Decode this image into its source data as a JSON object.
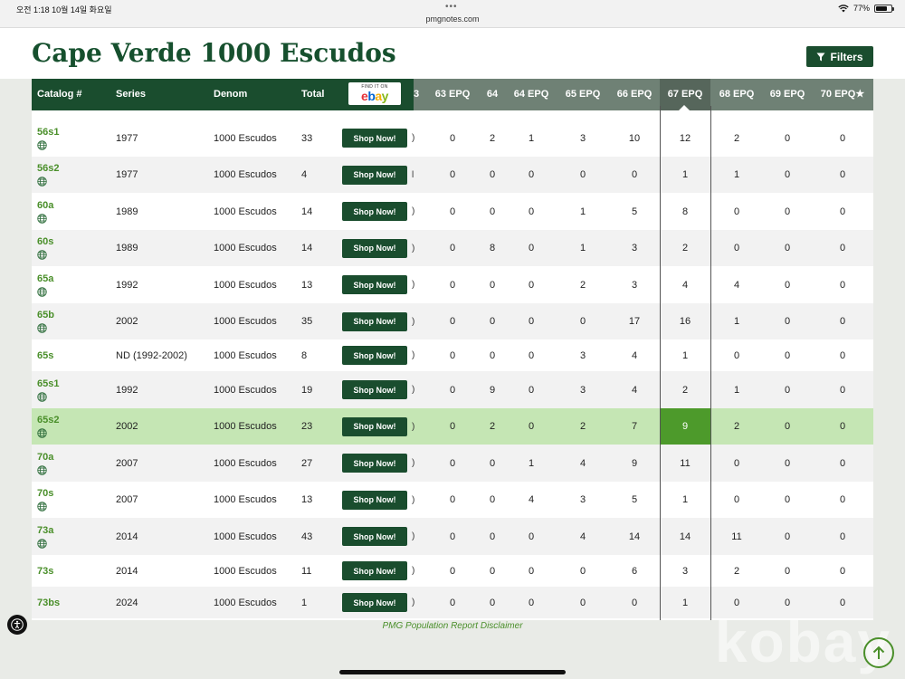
{
  "status_bar": {
    "time": "오전 1:18   10월 14일 화요일",
    "dots": "•••",
    "url": "pmgnotes.com",
    "battery": "77%"
  },
  "header": {
    "title": "Cape Verde 1000 Escudos",
    "filters_label": "Filters"
  },
  "table": {
    "columns": {
      "catalog": "Catalog #",
      "series": "Series",
      "denom": "Denom",
      "total": "Total",
      "cut": "3",
      "c63epq": "63 EPQ",
      "c64": "64",
      "c64epq": "64 EPQ",
      "c65epq": "65 EPQ",
      "c66epq": "66 EPQ",
      "c67epq": "67 EPQ",
      "c68epq": "68 EPQ",
      "c69epq": "69 EPQ",
      "c70epq": "70 EPQ★"
    },
    "ebay": {
      "find": "FIND IT ON",
      "logo": "ebay"
    },
    "shop_label": "Shop Now!",
    "rows": [
      {
        "cat": "56s1",
        "series": "1977",
        "denom": "1000 Escudos",
        "total": "33",
        "cut": ")",
        "v": [
          "0",
          "2",
          "1",
          "3",
          "10",
          "12",
          "2",
          "0",
          "0"
        ]
      },
      {
        "cat": "56s2",
        "series": "1977",
        "denom": "1000 Escudos",
        "total": "4",
        "cut": "l",
        "v": [
          "0",
          "0",
          "0",
          "0",
          "0",
          "1",
          "1",
          "0",
          "0"
        ]
      },
      {
        "cat": "60a",
        "series": "1989",
        "denom": "1000 Escudos",
        "total": "14",
        "cut": ")",
        "v": [
          "0",
          "0",
          "0",
          "1",
          "5",
          "8",
          "0",
          "0",
          "0"
        ]
      },
      {
        "cat": "60s",
        "series": "1989",
        "denom": "1000 Escudos",
        "total": "14",
        "cut": ")",
        "v": [
          "0",
          "8",
          "0",
          "1",
          "3",
          "2",
          "0",
          "0",
          "0"
        ]
      },
      {
        "cat": "65a",
        "series": "1992",
        "denom": "1000 Escudos",
        "total": "13",
        "cut": ")",
        "v": [
          "0",
          "0",
          "0",
          "2",
          "3",
          "4",
          "4",
          "0",
          "0"
        ]
      },
      {
        "cat": "65b",
        "series": "2002",
        "denom": "1000 Escudos",
        "total": "35",
        "cut": ")",
        "v": [
          "0",
          "0",
          "0",
          "0",
          "17",
          "16",
          "1",
          "0",
          "0"
        ]
      },
      {
        "cat": "65s",
        "series": "ND (1992-2002)",
        "denom": "1000 Escudos",
        "total": "8",
        "cut": ")",
        "v": [
          "0",
          "0",
          "0",
          "3",
          "4",
          "1",
          "0",
          "0",
          "0"
        ]
      },
      {
        "cat": "65s1",
        "series": "1992",
        "denom": "1000 Escudos",
        "total": "19",
        "cut": ")",
        "v": [
          "0",
          "9",
          "0",
          "3",
          "4",
          "2",
          "1",
          "0",
          "0"
        ]
      },
      {
        "cat": "65s2",
        "series": "2002",
        "denom": "1000 Escudos",
        "total": "23",
        "cut": ")",
        "v": [
          "0",
          "2",
          "0",
          "2",
          "7",
          "9",
          "2",
          "0",
          "0"
        ]
      },
      {
        "cat": "70a",
        "series": "2007",
        "denom": "1000 Escudos",
        "total": "27",
        "cut": ")",
        "v": [
          "0",
          "0",
          "1",
          "4",
          "9",
          "11",
          "0",
          "0",
          "0"
        ]
      },
      {
        "cat": "70s",
        "series": "2007",
        "denom": "1000 Escudos",
        "total": "13",
        "cut": ")",
        "v": [
          "0",
          "0",
          "4",
          "3",
          "5",
          "1",
          "0",
          "0",
          "0"
        ]
      },
      {
        "cat": "73a",
        "series": "2014",
        "denom": "1000 Escudos",
        "total": "43",
        "cut": ")",
        "v": [
          "0",
          "0",
          "0",
          "4",
          "14",
          "14",
          "11",
          "0",
          "0"
        ]
      },
      {
        "cat": "73s",
        "series": "2014",
        "denom": "1000 Escudos",
        "total": "11",
        "cut": ")",
        "v": [
          "0",
          "0",
          "0",
          "0",
          "6",
          "3",
          "2",
          "0",
          "0"
        ]
      },
      {
        "cat": "73bs",
        "series": "2024",
        "denom": "1000 Escudos",
        "total": "1",
        "cut": ")",
        "v": [
          "0",
          "0",
          "0",
          "0",
          "0",
          "1",
          "0",
          "0",
          "0"
        ]
      }
    ]
  },
  "disclaimer": "PMG Population Report Disclaimer",
  "watermark": "kobay",
  "colors": {
    "header_green": "#1a4d2e",
    "accent_green": "#4a8f2a",
    "highlight_row": "#c5e6b4",
    "highlight_cell": "#4d9a2b"
  }
}
